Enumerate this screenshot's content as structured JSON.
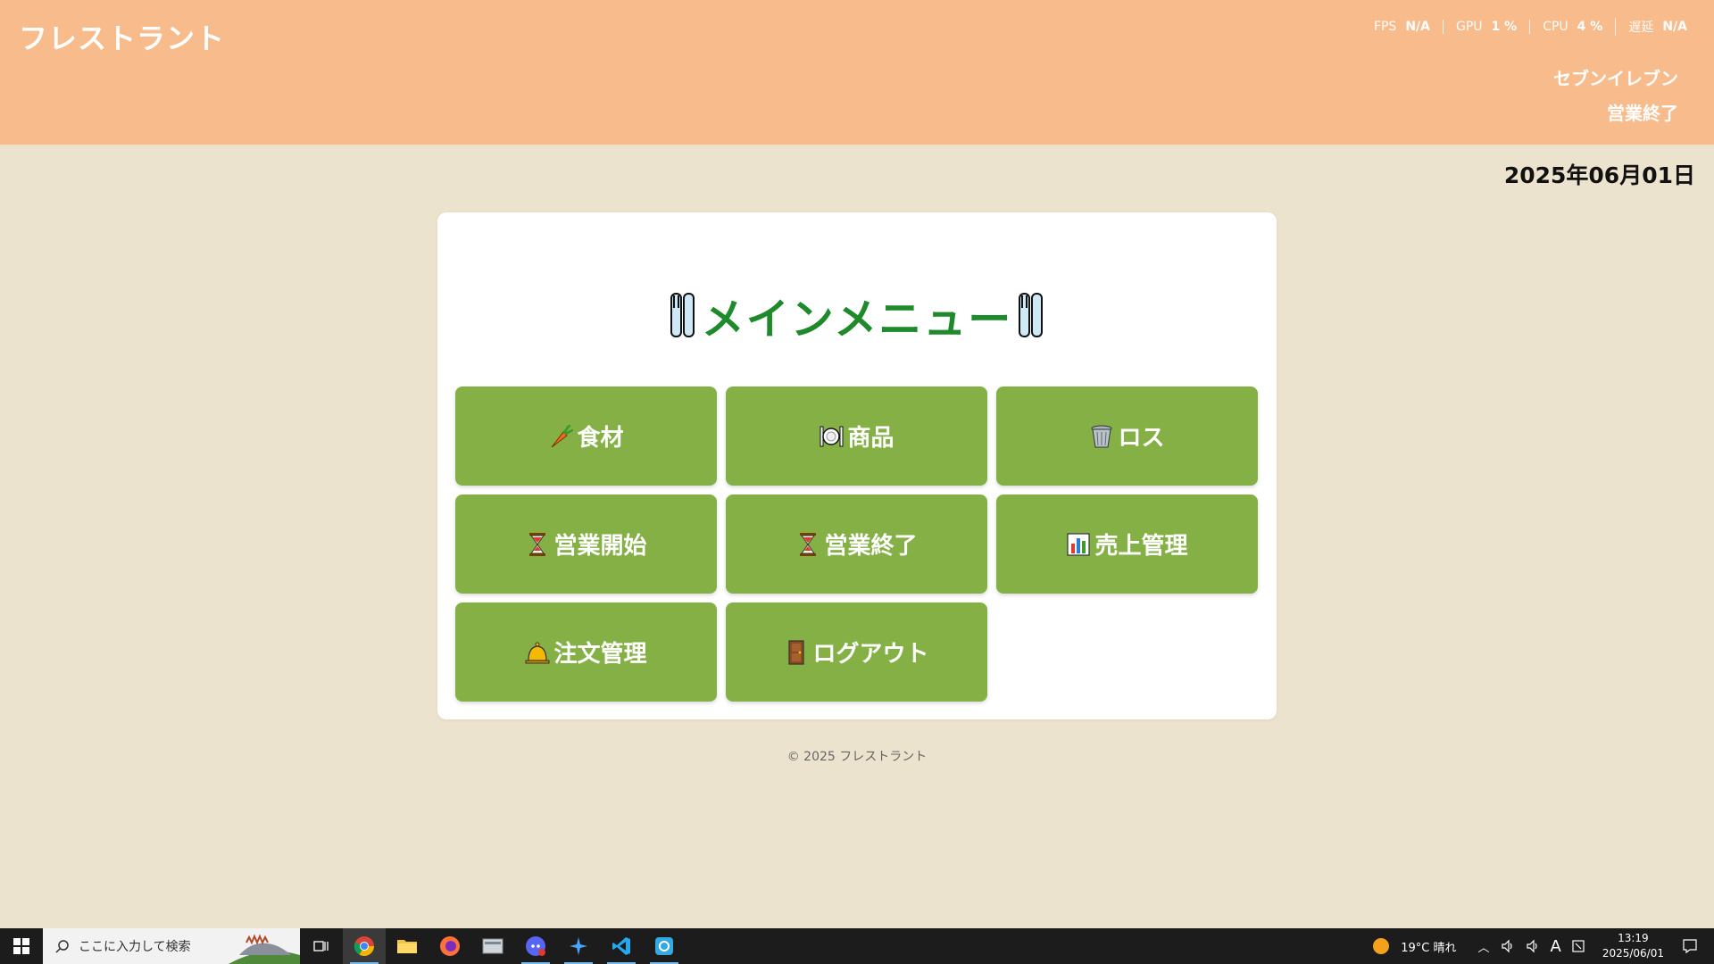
{
  "header": {
    "app_title": "フレストラント",
    "perf": [
      {
        "label": "FPS",
        "value": "N/A"
      },
      {
        "label": "GPU",
        "value": "1 %"
      },
      {
        "label": "CPU",
        "value": "4 %"
      },
      {
        "label": "遅延",
        "value": "N/A"
      }
    ],
    "store_name": "セブンイレブン",
    "store_status": "営業終了"
  },
  "date": "2025年06月01日",
  "main_menu": {
    "title": "メインメニュー",
    "buttons": [
      {
        "label": "食材",
        "icon": "carrot-icon"
      },
      {
        "label": "商品",
        "icon": "plate-icon"
      },
      {
        "label": "ロス",
        "icon": "trash-icon"
      },
      {
        "label": "営業開始",
        "icon": "hourglass-icon"
      },
      {
        "label": "営業終了",
        "icon": "hourglass-icon"
      },
      {
        "label": "売上管理",
        "icon": "bar-chart-icon"
      },
      {
        "label": "注文管理",
        "icon": "bell-icon"
      },
      {
        "label": "ログアウト",
        "icon": "door-icon"
      }
    ]
  },
  "footer": "© 2025 フレストラント",
  "taskbar": {
    "search_placeholder": "ここに入力して検索",
    "weather": "19°C 晴れ",
    "ime": "A",
    "time": "13:19",
    "date": "2025/06/01"
  },
  "colors": {
    "header": "#f7bb8c",
    "background": "#ebe3cd",
    "button": "#85b046",
    "title": "#1f8a2b"
  }
}
